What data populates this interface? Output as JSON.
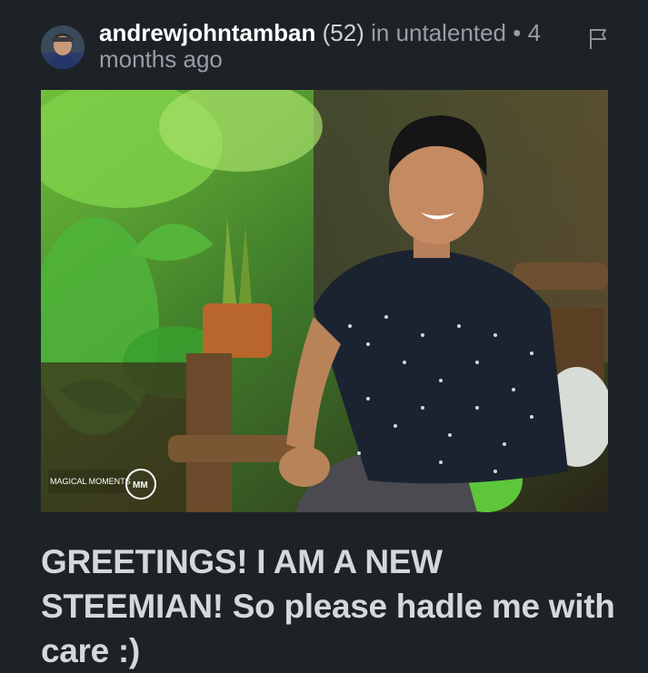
{
  "post": {
    "author": "andrewjohntamban",
    "reputation": "(52)",
    "in_text": "in",
    "community": "untalented",
    "separator": "•",
    "time": "4 months ago",
    "title": "GREETINGS! I AM A NEW STEEMIAN! So please hadle me with care :)",
    "watermark": "MAGICAL MOMENTS"
  },
  "icons": {
    "flag": "flag-icon",
    "avatar": "avatar"
  },
  "colors": {
    "background": "#1d2226",
    "author": "#ffffff",
    "meta": "#969ea6",
    "title": "#d4d8dc"
  }
}
